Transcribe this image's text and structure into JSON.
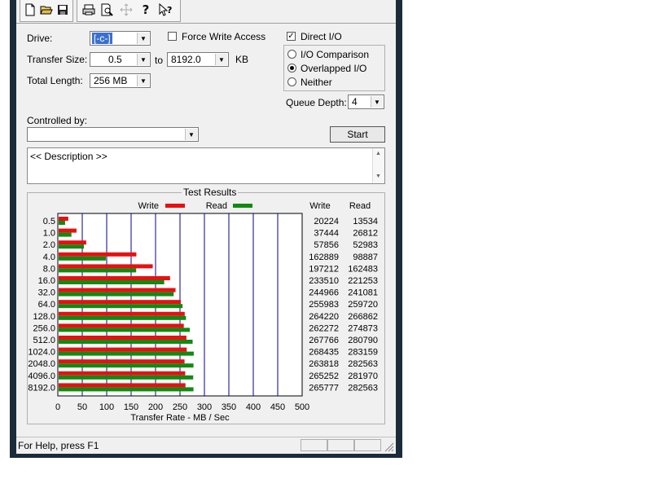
{
  "toolbar": {
    "icons": [
      "new-icon",
      "open-icon",
      "save-icon",
      "print-icon",
      "print-preview-icon",
      "move-icon",
      "help-icon",
      "context-help-icon"
    ]
  },
  "form": {
    "drive_label": "Drive:",
    "drive_value": "[-c-]",
    "force_write_label": "Force Write Access",
    "force_write_checked": false,
    "direct_io_label": "Direct I/O",
    "direct_io_checked": true,
    "transfer_size_label": "Transfer Size:",
    "transfer_from": "0.5",
    "to_label": "to",
    "transfer_to": "8192.0",
    "kb_label": "KB",
    "total_length_label": "Total Length:",
    "total_length_value": "256 MB",
    "io_options": [
      "I/O Comparison",
      "Overlapped I/O",
      "Neither"
    ],
    "io_selected": "Overlapped I/O",
    "queue_depth_label": "Queue Depth:",
    "queue_depth_value": "4",
    "controlled_by_label": "Controlled by:",
    "controlled_by_value": "",
    "start_label": "Start",
    "description": "<< Description >>"
  },
  "results": {
    "title": "Test Results",
    "legend_write": "Write",
    "legend_read": "Read",
    "col_write": "Write",
    "col_read": "Read",
    "xlabel": "Transfer Rate - MB / Sec"
  },
  "chart_data": {
    "type": "bar",
    "orientation": "horizontal",
    "title": "Test Results",
    "xlabel": "Transfer Rate - MB / Sec",
    "xlim": [
      0,
      500
    ],
    "xticks": [
      "0",
      "50",
      "100",
      "150",
      "200",
      "250",
      "300",
      "350",
      "400",
      "450",
      "500"
    ],
    "categories": [
      "0.5",
      "1.0",
      "2.0",
      "4.0",
      "8.0",
      "16.0",
      "32.0",
      "64.0",
      "128.0",
      "256.0",
      "512.0",
      "1024.0",
      "2048.0",
      "4096.0",
      "8192.0"
    ],
    "series": [
      {
        "name": "Write",
        "color": "#e81010",
        "values_kb": [
          20224,
          37444,
          57856,
          162889,
          197212,
          233510,
          244966,
          255983,
          264220,
          262272,
          267766,
          268435,
          263818,
          265252,
          265777
        ],
        "labels": [
          "20224",
          "37444",
          "57856",
          "162889",
          "197212",
          "233510",
          "244966",
          "255983",
          "264220",
          "262272",
          "267766",
          "268435",
          "263818",
          "265252",
          "265777"
        ]
      },
      {
        "name": "Read",
        "color": "#108a10",
        "values_kb": [
          13534,
          26812,
          52983,
          98887,
          162483,
          221253,
          241081,
          259720,
          266862,
          274873,
          280790,
          283159,
          282563,
          281970,
          282563
        ],
        "labels": [
          "13534",
          "26812",
          "52983",
          "98887",
          "162483",
          "221253",
          "241081",
          "259720",
          "266862",
          "274873",
          "280790",
          "283159",
          "282563",
          "281970",
          "282563"
        ]
      }
    ],
    "grid": true
  },
  "status": {
    "text": "For Help, press F1"
  },
  "colors": {
    "write": "#e81010",
    "read": "#108a10",
    "grid": "#00008b",
    "window_frame": "#1c2b3a"
  }
}
